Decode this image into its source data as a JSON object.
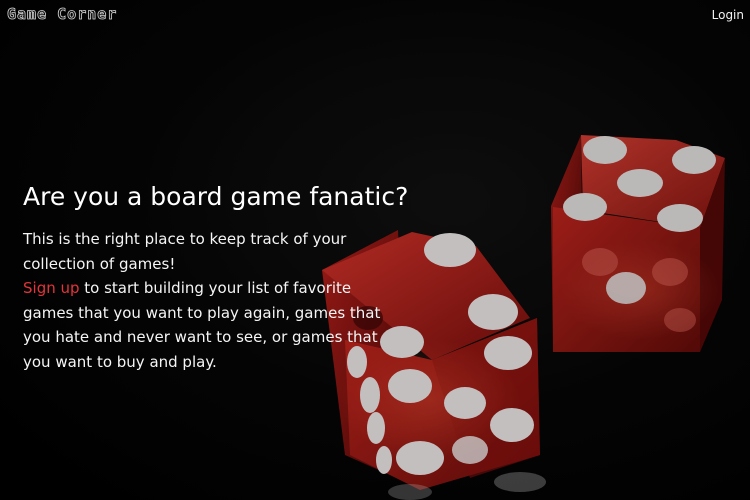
{
  "nav": {
    "logo": "Game Corner",
    "login": "Login"
  },
  "hero": {
    "title": "Are you a board game fanatic?",
    "intro": "This is the right place to keep track of your collection of games!",
    "signup_link": "Sign up",
    "body": " to start building your list of favorite games that you want to play again, games that you hate and never want to see, or games that you want to buy and play."
  },
  "colors": {
    "background": "#000000",
    "accent": "#e3343a",
    "dice": "#c8231f",
    "pips": "#f0eded"
  }
}
